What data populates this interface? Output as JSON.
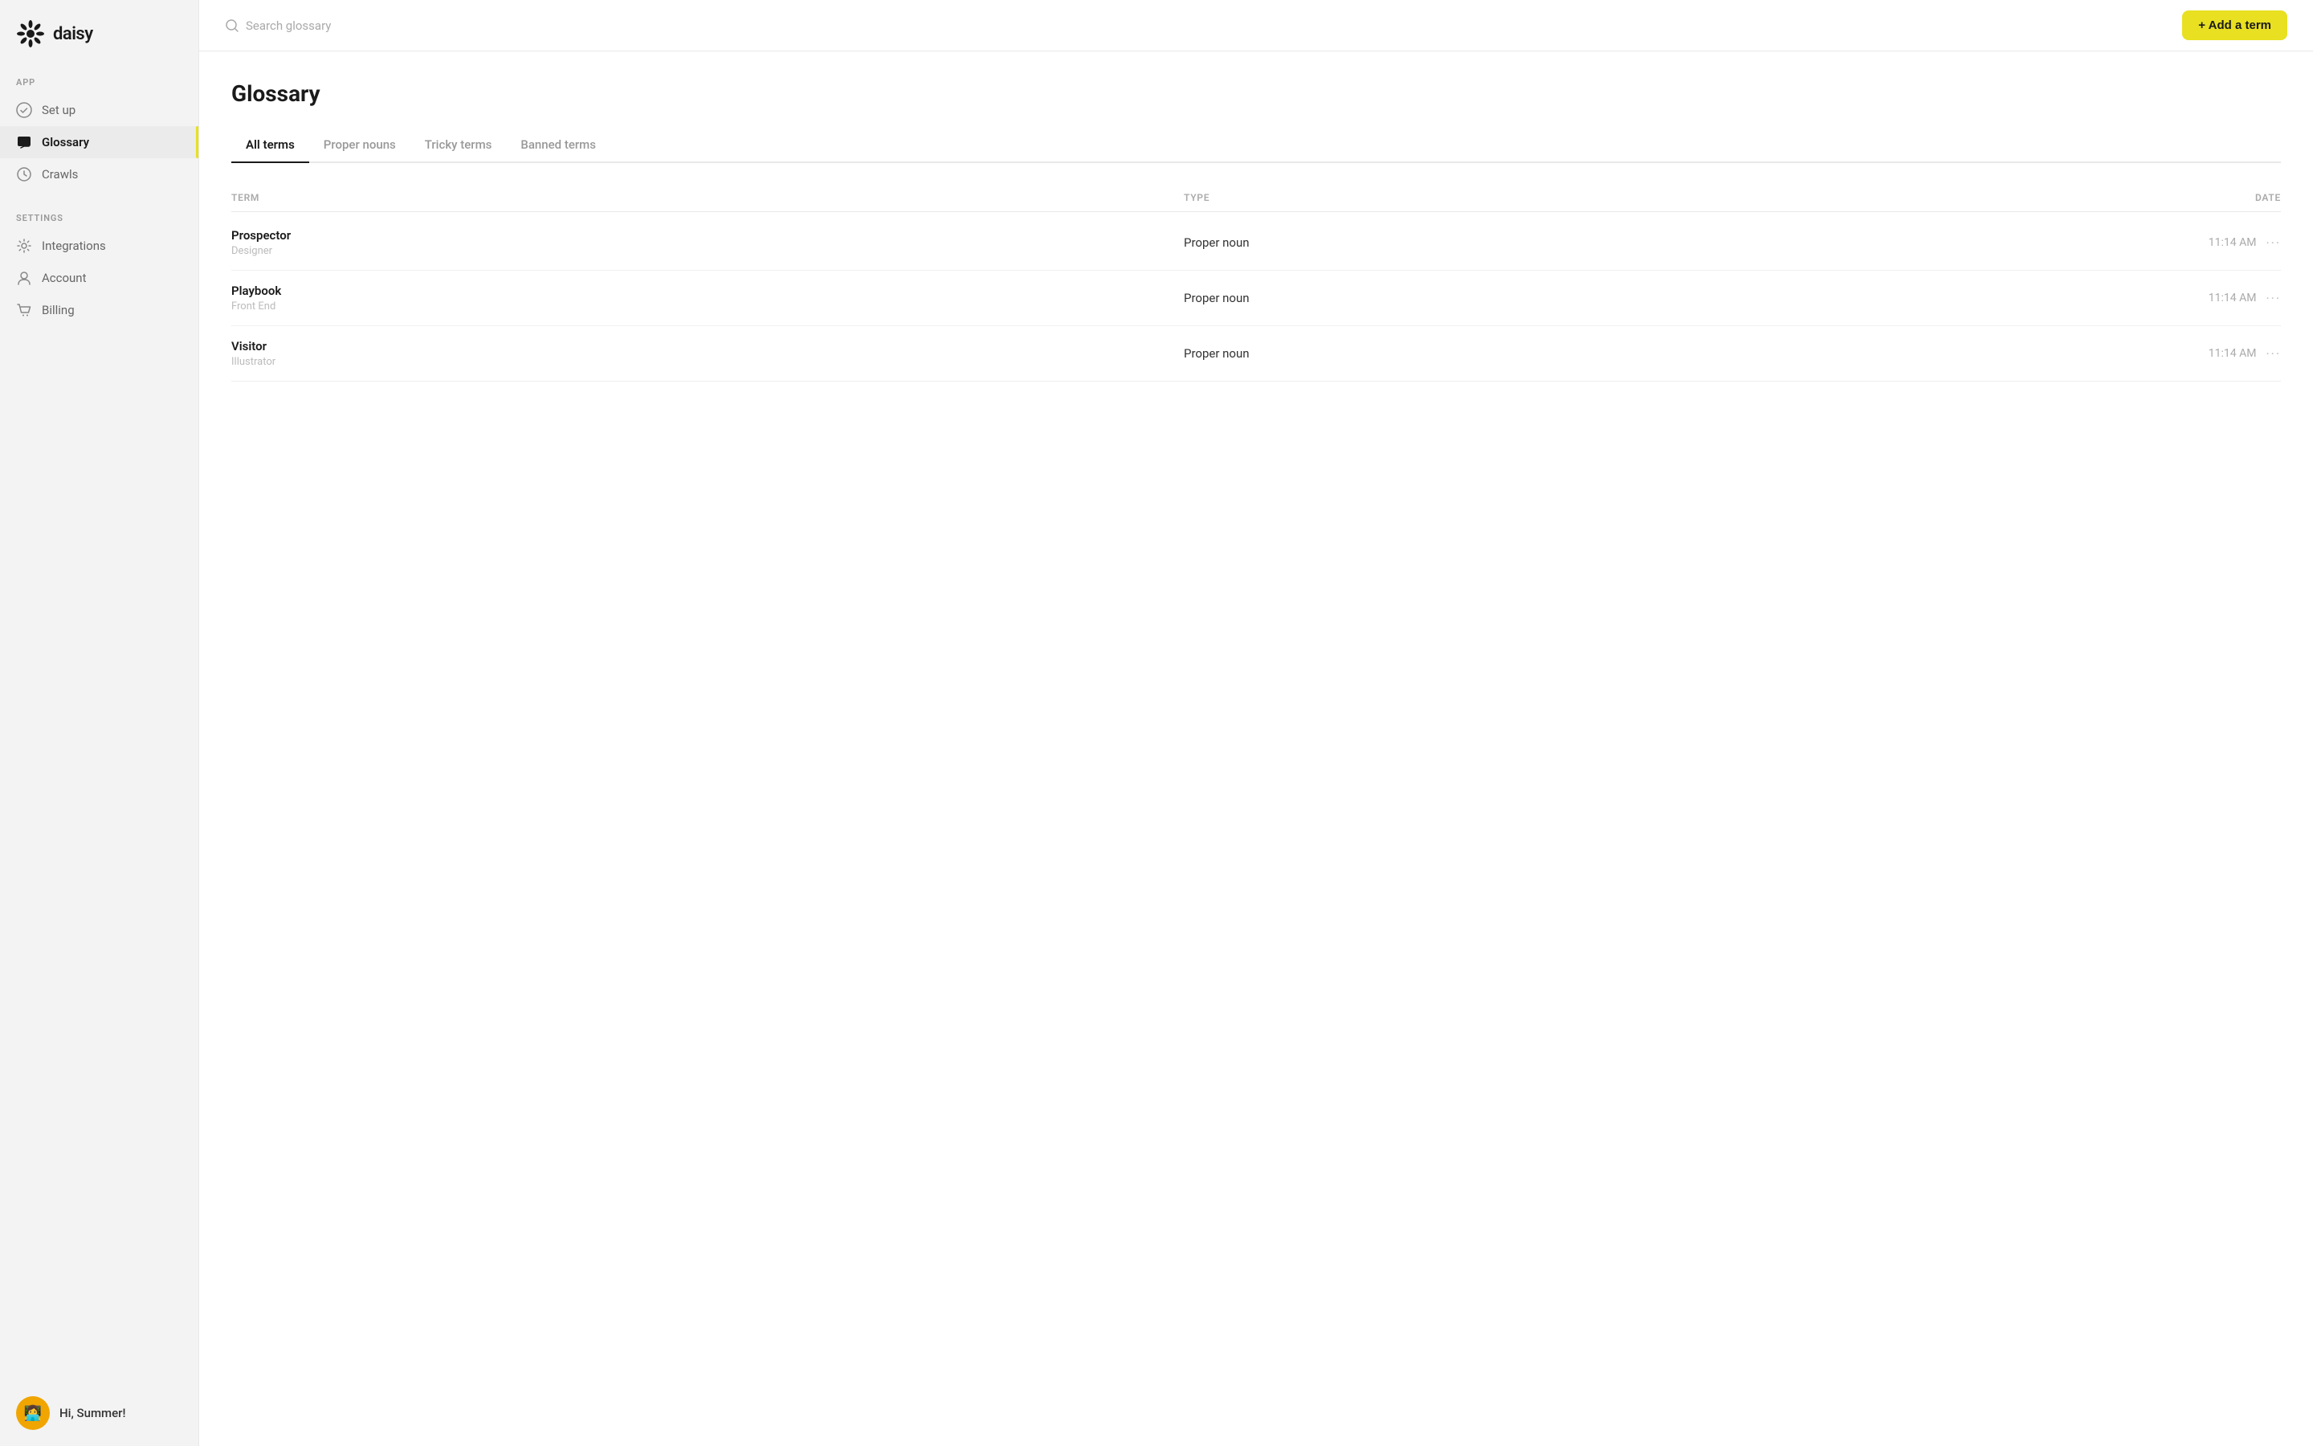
{
  "app": {
    "logo_text": "daisy"
  },
  "sidebar": {
    "app_section_label": "APP",
    "settings_section_label": "SETTINGS",
    "nav_items": [
      {
        "id": "setup",
        "label": "Set up",
        "icon": "check-circle-icon",
        "active": false
      },
      {
        "id": "glossary",
        "label": "Glossary",
        "icon": "chat-icon",
        "active": true
      },
      {
        "id": "crawls",
        "label": "Crawls",
        "icon": "clock-icon",
        "active": false
      }
    ],
    "settings_items": [
      {
        "id": "integrations",
        "label": "Integrations",
        "icon": "gear-icon"
      },
      {
        "id": "account",
        "label": "Account",
        "icon": "person-icon"
      },
      {
        "id": "billing",
        "label": "Billing",
        "icon": "cart-icon"
      }
    ],
    "user_greeting": "Hi, Summer!",
    "user_avatar_emoji": "👩‍💻"
  },
  "topbar": {
    "search_placeholder": "Search glossary",
    "add_term_button": "+ Add a term"
  },
  "page": {
    "title": "Glossary",
    "tabs": [
      {
        "id": "all-terms",
        "label": "All terms",
        "active": true
      },
      {
        "id": "proper-nouns",
        "label": "Proper nouns",
        "active": false
      },
      {
        "id": "tricky-terms",
        "label": "Tricky terms",
        "active": false
      },
      {
        "id": "banned-terms",
        "label": "Banned terms",
        "active": false
      }
    ],
    "table": {
      "col_term": "TERM",
      "col_type": "TYPE",
      "col_date": "DATE",
      "rows": [
        {
          "name": "Prospector",
          "subtitle": "Designer",
          "type": "Proper noun",
          "date": "11:14 AM"
        },
        {
          "name": "Playbook",
          "subtitle": "Front End",
          "type": "Proper noun",
          "date": "11:14 AM"
        },
        {
          "name": "Visitor",
          "subtitle": "Illustrator",
          "type": "Proper noun",
          "date": "11:14 AM"
        }
      ]
    }
  }
}
